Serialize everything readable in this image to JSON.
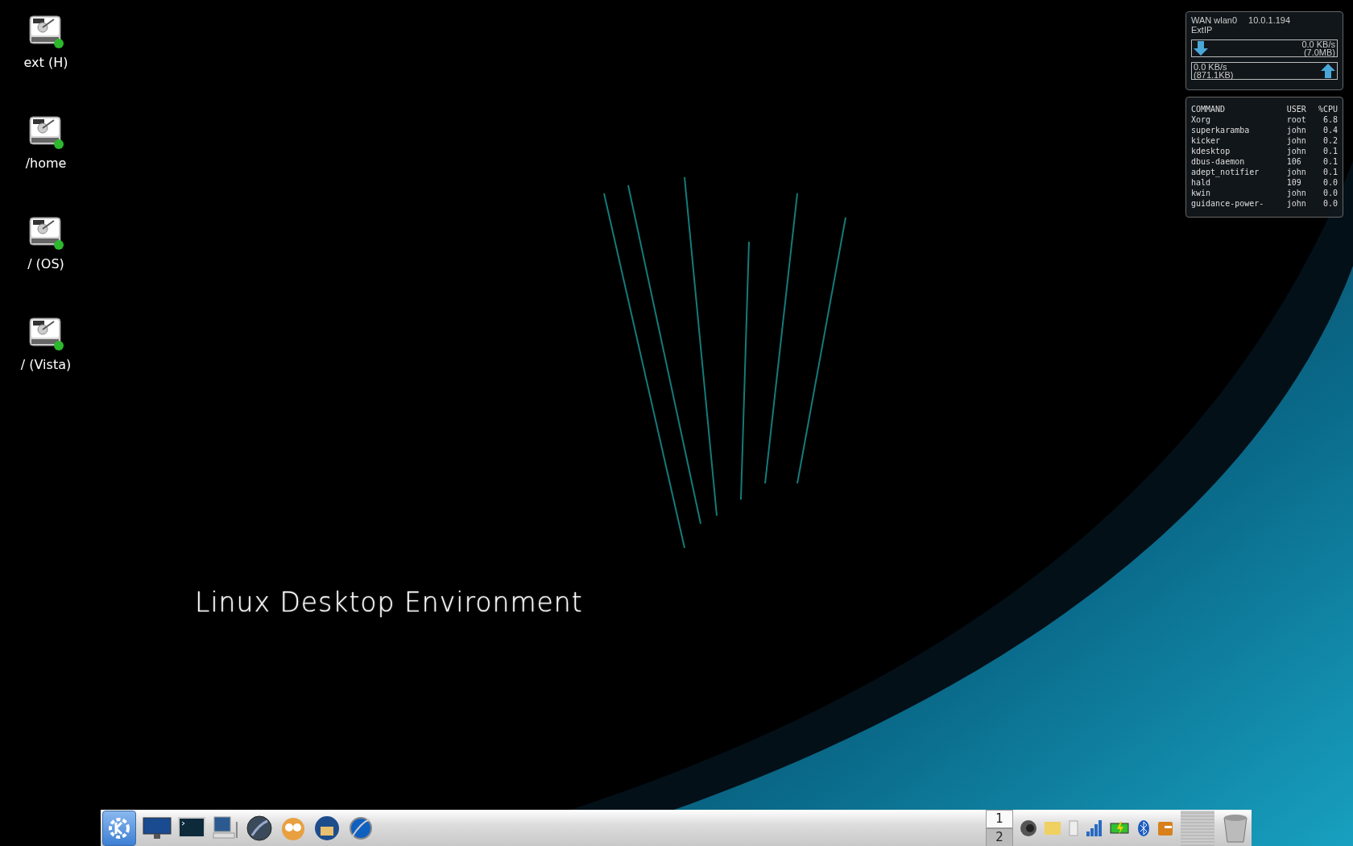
{
  "desktop_icons": [
    {
      "label": "ext (H)"
    },
    {
      "label": "/home"
    },
    {
      "label": "/ (OS)"
    },
    {
      "label": "/ (Vista)"
    }
  ],
  "wallpaper": {
    "title": "Linux Desktop Environment"
  },
  "network_widget": {
    "interface": "WAN wlan0",
    "ip": "10.0.1.194",
    "ext_ip_label": "ExtIP",
    "download": {
      "rate": "0.0 KB/s",
      "total": "(7.0MB)"
    },
    "upload": {
      "rate": "0.0 KB/s",
      "total": "(871.1KB)"
    }
  },
  "process_widget": {
    "columns": [
      "COMMAND",
      "USER",
      "%CPU"
    ],
    "rows": [
      [
        "Xorg",
        "root",
        "6.8"
      ],
      [
        "superkaramba",
        "john",
        "0.4"
      ],
      [
        "kicker",
        "john",
        "0.2"
      ],
      [
        "kdesktop",
        "john",
        "0.1"
      ],
      [
        "dbus-daemon",
        "106",
        "0.1"
      ],
      [
        "adept_notifier",
        "john",
        "0.1"
      ],
      [
        "hald",
        "109",
        "0.0"
      ],
      [
        "kwin",
        "john",
        "0.0"
      ],
      [
        "guidance-power-",
        "john",
        "0.0"
      ]
    ]
  },
  "taskbar": {
    "pager": [
      {
        "label": "1",
        "selected": true
      },
      {
        "label": "2",
        "selected": false
      }
    ]
  }
}
